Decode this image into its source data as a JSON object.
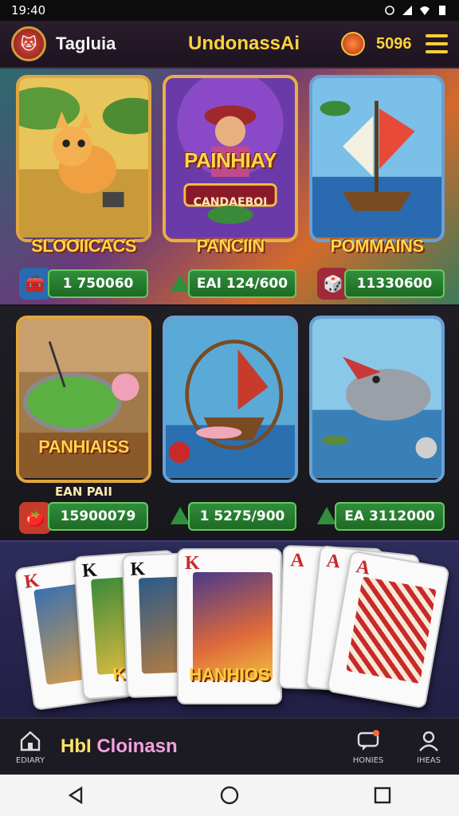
{
  "status_bar": {
    "time": "19:40"
  },
  "header": {
    "app_name": "Tagluia",
    "title": "UndonassAi",
    "balance": "5096"
  },
  "games": [
    {
      "title": "SLOOIICACS",
      "amount": "1 750060"
    },
    {
      "title": "PANCIIN",
      "art_title": "PAINHIAY",
      "art_sub": "CANDAEBOI",
      "amount": "EAI 124/600"
    },
    {
      "title": "POMMAINS",
      "amount": "11330600"
    },
    {
      "title": "PANHIAISS",
      "sub": "EAN PAII",
      "amount": "15900079"
    },
    {
      "title": "",
      "amount": "1 5275/900"
    },
    {
      "title": "",
      "amount": "EA 3112000"
    }
  ],
  "cards": {
    "label_left": "KAA",
    "label_center": "HANHIOS",
    "ranks": [
      "K",
      "K",
      "K",
      "K",
      "A",
      "A",
      "A"
    ]
  },
  "bottom_nav": {
    "home_label": "EDIARY",
    "center_text_a": "HbI",
    "center_text_b": "Cloinasn",
    "right1_label": "HONIES",
    "right2_label": "IHEAS"
  },
  "colors": {
    "accent": "#ffd23a",
    "green": "#2f8f3a",
    "tile_border": "#e0a640"
  },
  "icons": [
    "logo-icon",
    "coin-icon",
    "menu-icon",
    "home-icon",
    "chat-icon",
    "profile-icon",
    "back-icon",
    "home-circle-icon",
    "recents-icon"
  ]
}
